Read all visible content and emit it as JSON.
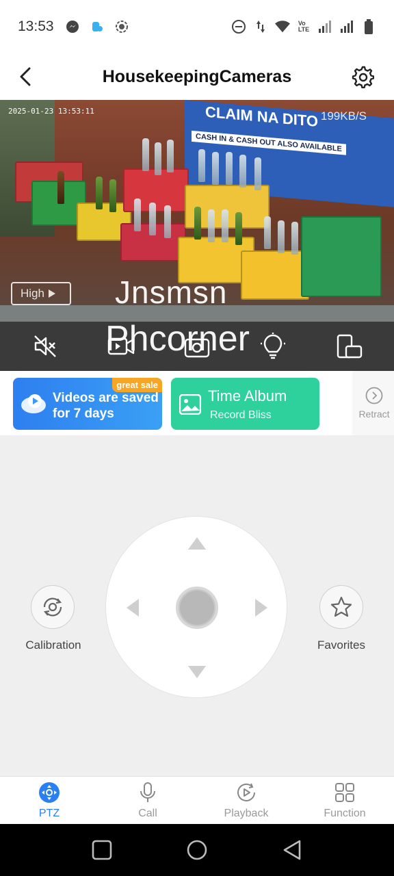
{
  "status_bar": {
    "time": "13:53",
    "left_icons": [
      "messenger-icon",
      "notification-app-icon",
      "screen-record-icon"
    ],
    "right_icons": [
      "do-not-disturb-icon",
      "data-arrows-icon",
      "wifi-icon",
      "volte-icon",
      "signal-icon",
      "signal-icon",
      "battery-icon"
    ]
  },
  "header": {
    "title": "HousekeepingCameras",
    "back_icon": "chevron-left-icon",
    "settings_icon": "gear-icon"
  },
  "video": {
    "timestamp": "2025-01-23 13:53:11",
    "bitrate": "199KB/S",
    "quality_label": "High",
    "quality_icon": "play-triangle-icon",
    "banner_text": "CLAIM NA DITO",
    "banner_subtext": "CASH IN & CASH OUT ALSO AVAILABLE"
  },
  "watermark": {
    "line1": "Jnsmsn",
    "line2": "Phcorner"
  },
  "controls": {
    "items": [
      {
        "icon": "speaker-muted-icon"
      },
      {
        "icon": "video-record-icon"
      },
      {
        "icon": "snapshot-icon"
      },
      {
        "icon": "light-bulb-icon"
      },
      {
        "icon": "screen-rotate-icon"
      }
    ]
  },
  "promos": {
    "cloud": {
      "label": "Videos are saved for 7 days",
      "badge": "great sale",
      "icon": "cloud-play-icon"
    },
    "album": {
      "title": "Time Album",
      "subtitle": "Record Bliss",
      "icon": "image-icon"
    },
    "retract_label": "Retract",
    "retract_icon": "chevron-right-circle-icon"
  },
  "ptz": {
    "calibration_label": "Calibration",
    "calibration_icon": "calibration-icon",
    "favorites_label": "Favorites",
    "favorites_icon": "star-icon"
  },
  "tabs": [
    {
      "label": "PTZ",
      "icon": "ptz-icon",
      "active": true
    },
    {
      "label": "Call",
      "icon": "microphone-icon",
      "active": false
    },
    {
      "label": "Playback",
      "icon": "playback-icon",
      "active": false
    },
    {
      "label": "Function",
      "icon": "grid-icon",
      "active": false
    }
  ],
  "colors": {
    "accent": "#2a7ff2",
    "promo_blue": "#2e7ff0",
    "promo_green": "#2ed19b",
    "sale_badge": "#f6a623",
    "control_bar": "#3a3a3a"
  }
}
